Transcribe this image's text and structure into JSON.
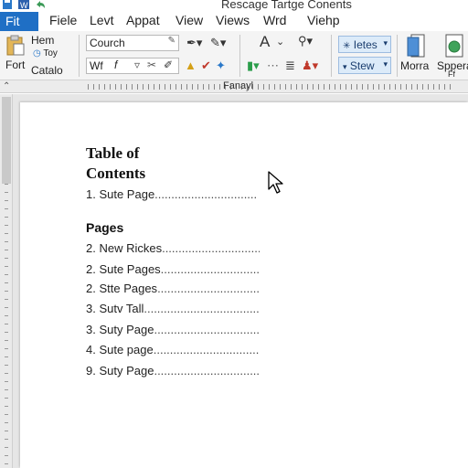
{
  "window": {
    "title": "Rescage Tartge Conents"
  },
  "menu": {
    "file_tab": "Fit",
    "items": [
      "Fiele",
      "Levt",
      "Appat",
      "View",
      "Views",
      "Wrd",
      "Viehp"
    ]
  },
  "ribbon": {
    "clipboard": {
      "paste_label": "Fort",
      "item1": "Hem",
      "item2": "Toy",
      "item3": "Catalo"
    },
    "font_box": {
      "value": "Courch"
    },
    "font_row2": {
      "value": "Wf",
      "italic": "f"
    },
    "styles": {
      "style1": "Ietes",
      "style2": "Stew"
    },
    "right_buttons": {
      "b1": "Morra",
      "b2": "Sppera",
      "b2_sub": "Ff"
    }
  },
  "ruler": {
    "label": "Fanayl"
  },
  "document": {
    "toc_title_line1": "Table of",
    "toc_title_line2": "Contents",
    "first_entry": {
      "text": "1. Sute Page",
      "dots": "..............................."
    },
    "section_heading": "Pages",
    "entries": [
      {
        "text": "2. New Rickes",
        "dots": ".............................."
      },
      {
        "text": "2. Sute Pages",
        "dots": "..............................."
      },
      {
        "text": "2. Stte Pages",
        "dots": "..............................."
      },
      {
        "text": "3. Sutv Tall",
        "dots": "..................................."
      },
      {
        "text": "3. Suty Page",
        "dots": "................................."
      },
      {
        "text": "4. Sute page",
        "dots": "................................."
      },
      {
        "text": "9. Suty Page",
        "dots": "................................."
      }
    ]
  },
  "colors": {
    "accent": "#1f6fc5",
    "style_highlight": "#dcebf9",
    "ribbon_bg": "#f4f4f4"
  },
  "icons": [
    "save-icon",
    "word-icon",
    "paste-icon",
    "find-icon",
    "cursor-icon",
    "document-icon"
  ]
}
